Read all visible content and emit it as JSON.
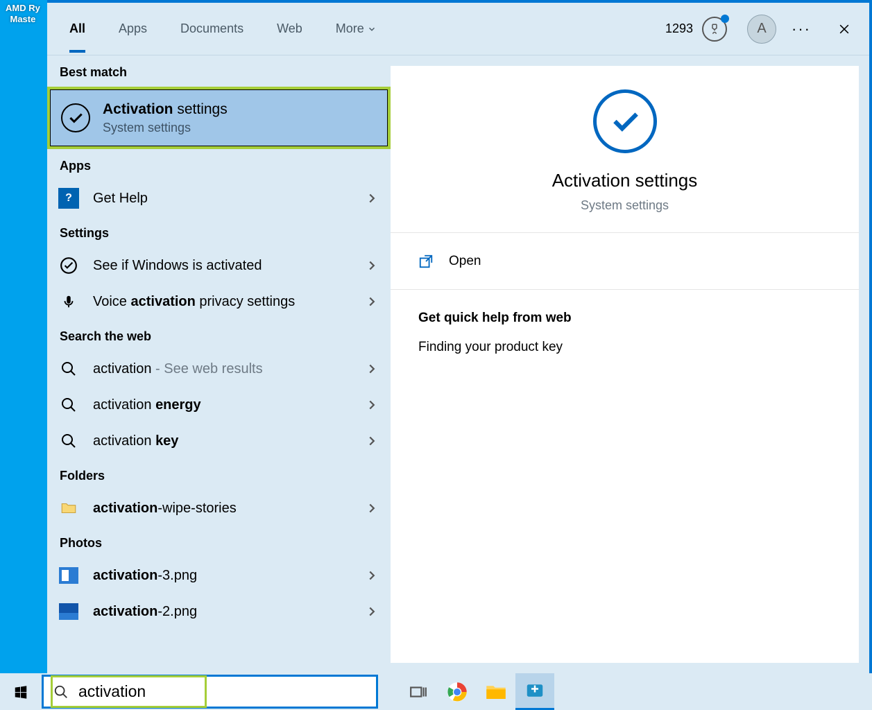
{
  "desktop": {
    "icon_line1": "AMD Ry",
    "icon_line2": "Maste"
  },
  "tabs": {
    "all": "All",
    "apps": "Apps",
    "documents": "Documents",
    "web": "Web",
    "more": "More"
  },
  "header": {
    "points": "1293",
    "avatar_initial": "A"
  },
  "sections": {
    "best_match": "Best match",
    "apps": "Apps",
    "settings": "Settings",
    "search_web": "Search the web",
    "folders": "Folders",
    "photos": "Photos"
  },
  "best_match": {
    "title_bold": "Activation",
    "title_rest": " settings",
    "subtitle": "System settings"
  },
  "apps_list": {
    "get_help": "Get Help"
  },
  "settings_list": {
    "see_activated": "See if Windows is activated",
    "voice_pre": "Voice ",
    "voice_bold": "activation",
    "voice_post": " privacy settings"
  },
  "web_list": {
    "w1_pre": "activation",
    "w1_post": " - See web results",
    "w2_pre": "activation ",
    "w2_bold": "energy",
    "w3_pre": "activation ",
    "w3_bold": "key"
  },
  "folders_list": {
    "f1_bold": "activation",
    "f1_post": "-wipe-stories"
  },
  "photos_list": {
    "p1_bold": "activation",
    "p1_post": "-3.png",
    "p2_bold": "activation",
    "p2_post": "-2.png"
  },
  "detail": {
    "title": "Activation settings",
    "subtitle": "System settings",
    "open": "Open",
    "help_header": "Get quick help from web",
    "help_link": "Finding your product key"
  },
  "search": {
    "value": "activation"
  }
}
